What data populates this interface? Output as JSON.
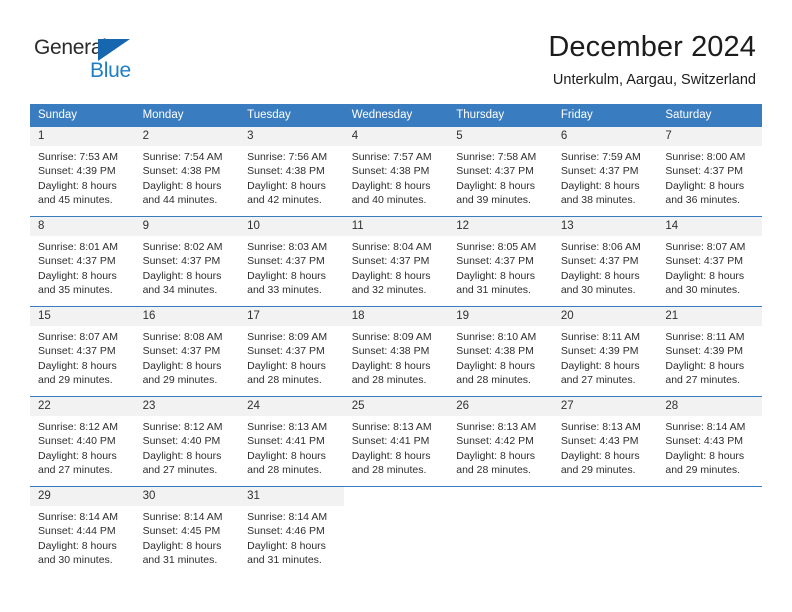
{
  "brand": {
    "name_part1": "General",
    "name_part2": "Blue",
    "triangle_icon": "triangle-icon"
  },
  "header": {
    "title": "December 2024",
    "subtitle": "Unterkulm, Aargau, Switzerland"
  },
  "colors": {
    "header_blue": "#3a7cc0",
    "brand_blue": "#1f7fc4",
    "triangle_blue": "#1666b0",
    "datenum_bg": "#f2f2f2",
    "text": "#2e2e2e"
  },
  "weekday_headers": [
    "Sunday",
    "Monday",
    "Tuesday",
    "Wednesday",
    "Thursday",
    "Friday",
    "Saturday"
  ],
  "weeks": [
    [
      {
        "day": "1",
        "sunrise": "Sunrise: 7:53 AM",
        "sunset": "Sunset: 4:39 PM",
        "daylight1": "Daylight: 8 hours",
        "daylight2": "and 45 minutes."
      },
      {
        "day": "2",
        "sunrise": "Sunrise: 7:54 AM",
        "sunset": "Sunset: 4:38 PM",
        "daylight1": "Daylight: 8 hours",
        "daylight2": "and 44 minutes."
      },
      {
        "day": "3",
        "sunrise": "Sunrise: 7:56 AM",
        "sunset": "Sunset: 4:38 PM",
        "daylight1": "Daylight: 8 hours",
        "daylight2": "and 42 minutes."
      },
      {
        "day": "4",
        "sunrise": "Sunrise: 7:57 AM",
        "sunset": "Sunset: 4:38 PM",
        "daylight1": "Daylight: 8 hours",
        "daylight2": "and 40 minutes."
      },
      {
        "day": "5",
        "sunrise": "Sunrise: 7:58 AM",
        "sunset": "Sunset: 4:37 PM",
        "daylight1": "Daylight: 8 hours",
        "daylight2": "and 39 minutes."
      },
      {
        "day": "6",
        "sunrise": "Sunrise: 7:59 AM",
        "sunset": "Sunset: 4:37 PM",
        "daylight1": "Daylight: 8 hours",
        "daylight2": "and 38 minutes."
      },
      {
        "day": "7",
        "sunrise": "Sunrise: 8:00 AM",
        "sunset": "Sunset: 4:37 PM",
        "daylight1": "Daylight: 8 hours",
        "daylight2": "and 36 minutes."
      }
    ],
    [
      {
        "day": "8",
        "sunrise": "Sunrise: 8:01 AM",
        "sunset": "Sunset: 4:37 PM",
        "daylight1": "Daylight: 8 hours",
        "daylight2": "and 35 minutes."
      },
      {
        "day": "9",
        "sunrise": "Sunrise: 8:02 AM",
        "sunset": "Sunset: 4:37 PM",
        "daylight1": "Daylight: 8 hours",
        "daylight2": "and 34 minutes."
      },
      {
        "day": "10",
        "sunrise": "Sunrise: 8:03 AM",
        "sunset": "Sunset: 4:37 PM",
        "daylight1": "Daylight: 8 hours",
        "daylight2": "and 33 minutes."
      },
      {
        "day": "11",
        "sunrise": "Sunrise: 8:04 AM",
        "sunset": "Sunset: 4:37 PM",
        "daylight1": "Daylight: 8 hours",
        "daylight2": "and 32 minutes."
      },
      {
        "day": "12",
        "sunrise": "Sunrise: 8:05 AM",
        "sunset": "Sunset: 4:37 PM",
        "daylight1": "Daylight: 8 hours",
        "daylight2": "and 31 minutes."
      },
      {
        "day": "13",
        "sunrise": "Sunrise: 8:06 AM",
        "sunset": "Sunset: 4:37 PM",
        "daylight1": "Daylight: 8 hours",
        "daylight2": "and 30 minutes."
      },
      {
        "day": "14",
        "sunrise": "Sunrise: 8:07 AM",
        "sunset": "Sunset: 4:37 PM",
        "daylight1": "Daylight: 8 hours",
        "daylight2": "and 30 minutes."
      }
    ],
    [
      {
        "day": "15",
        "sunrise": "Sunrise: 8:07 AM",
        "sunset": "Sunset: 4:37 PM",
        "daylight1": "Daylight: 8 hours",
        "daylight2": "and 29 minutes."
      },
      {
        "day": "16",
        "sunrise": "Sunrise: 8:08 AM",
        "sunset": "Sunset: 4:37 PM",
        "daylight1": "Daylight: 8 hours",
        "daylight2": "and 29 minutes."
      },
      {
        "day": "17",
        "sunrise": "Sunrise: 8:09 AM",
        "sunset": "Sunset: 4:37 PM",
        "daylight1": "Daylight: 8 hours",
        "daylight2": "and 28 minutes."
      },
      {
        "day": "18",
        "sunrise": "Sunrise: 8:09 AM",
        "sunset": "Sunset: 4:38 PM",
        "daylight1": "Daylight: 8 hours",
        "daylight2": "and 28 minutes."
      },
      {
        "day": "19",
        "sunrise": "Sunrise: 8:10 AM",
        "sunset": "Sunset: 4:38 PM",
        "daylight1": "Daylight: 8 hours",
        "daylight2": "and 28 minutes."
      },
      {
        "day": "20",
        "sunrise": "Sunrise: 8:11 AM",
        "sunset": "Sunset: 4:39 PM",
        "daylight1": "Daylight: 8 hours",
        "daylight2": "and 27 minutes."
      },
      {
        "day": "21",
        "sunrise": "Sunrise: 8:11 AM",
        "sunset": "Sunset: 4:39 PM",
        "daylight1": "Daylight: 8 hours",
        "daylight2": "and 27 minutes."
      }
    ],
    [
      {
        "day": "22",
        "sunrise": "Sunrise: 8:12 AM",
        "sunset": "Sunset: 4:40 PM",
        "daylight1": "Daylight: 8 hours",
        "daylight2": "and 27 minutes."
      },
      {
        "day": "23",
        "sunrise": "Sunrise: 8:12 AM",
        "sunset": "Sunset: 4:40 PM",
        "daylight1": "Daylight: 8 hours",
        "daylight2": "and 27 minutes."
      },
      {
        "day": "24",
        "sunrise": "Sunrise: 8:13 AM",
        "sunset": "Sunset: 4:41 PM",
        "daylight1": "Daylight: 8 hours",
        "daylight2": "and 28 minutes."
      },
      {
        "day": "25",
        "sunrise": "Sunrise: 8:13 AM",
        "sunset": "Sunset: 4:41 PM",
        "daylight1": "Daylight: 8 hours",
        "daylight2": "and 28 minutes."
      },
      {
        "day": "26",
        "sunrise": "Sunrise: 8:13 AM",
        "sunset": "Sunset: 4:42 PM",
        "daylight1": "Daylight: 8 hours",
        "daylight2": "and 28 minutes."
      },
      {
        "day": "27",
        "sunrise": "Sunrise: 8:13 AM",
        "sunset": "Sunset: 4:43 PM",
        "daylight1": "Daylight: 8 hours",
        "daylight2": "and 29 minutes."
      },
      {
        "day": "28",
        "sunrise": "Sunrise: 8:14 AM",
        "sunset": "Sunset: 4:43 PM",
        "daylight1": "Daylight: 8 hours",
        "daylight2": "and 29 minutes."
      }
    ],
    [
      {
        "day": "29",
        "sunrise": "Sunrise: 8:14 AM",
        "sunset": "Sunset: 4:44 PM",
        "daylight1": "Daylight: 8 hours",
        "daylight2": "and 30 minutes."
      },
      {
        "day": "30",
        "sunrise": "Sunrise: 8:14 AM",
        "sunset": "Sunset: 4:45 PM",
        "daylight1": "Daylight: 8 hours",
        "daylight2": "and 31 minutes."
      },
      {
        "day": "31",
        "sunrise": "Sunrise: 8:14 AM",
        "sunset": "Sunset: 4:46 PM",
        "daylight1": "Daylight: 8 hours",
        "daylight2": "and 31 minutes."
      },
      null,
      null,
      null,
      null
    ]
  ]
}
